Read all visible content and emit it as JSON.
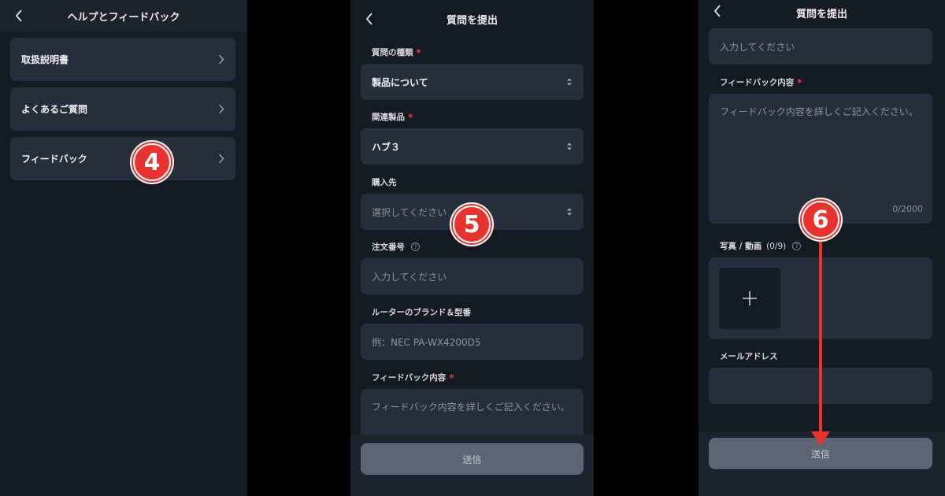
{
  "screen1": {
    "title": "ヘルプとフィードバック",
    "items": [
      {
        "label": "取扱説明書"
      },
      {
        "label": "よくあるご質問"
      },
      {
        "label": "フィードバック"
      }
    ]
  },
  "screen2": {
    "title": "質問を提出",
    "question_type": {
      "label": "質問の種類",
      "value": "製品について"
    },
    "related_product": {
      "label": "関連製品",
      "value": "ハブ３"
    },
    "purchase_place": {
      "label": "購入先",
      "placeholder": "選択してください"
    },
    "order_number": {
      "label": "注文番号",
      "help": "?",
      "placeholder": "入力してください"
    },
    "router_model": {
      "label": "ルーターのブランド＆型番",
      "placeholder": "例：NEC PA-WX4200D5"
    },
    "feedback": {
      "label": "フィードバック内容",
      "placeholder": "フィードバック内容を詳しくご記入ください。"
    },
    "submit_label": "送信"
  },
  "screen3": {
    "title": "質問を提出",
    "top_field_placeholder": "入力してください",
    "feedback": {
      "label": "フィードバック内容",
      "placeholder": "フィードバック内容を詳しくご記入ください。",
      "counter": "0/2000"
    },
    "photos": {
      "label": "写真 / 動画",
      "count": "(0/9)",
      "help": "?"
    },
    "email": {
      "label": "メールアドレス",
      "placeholder": ""
    },
    "submit_label": "送信"
  },
  "steps": {
    "s4": "4",
    "s5": "5",
    "s6": "6"
  },
  "colors": {
    "background": "#141a22",
    "card": "#252e3b",
    "accent": "#e8332f",
    "required": "#e53a3a",
    "button": "#5b6573"
  }
}
